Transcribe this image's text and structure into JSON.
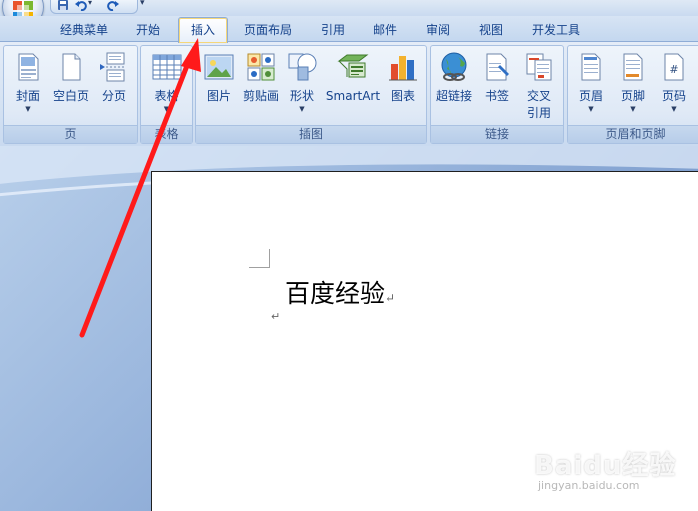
{
  "app": {
    "office_button_icon": "office-logo-icon",
    "quick_access": [
      "save-icon",
      "undo-icon",
      "redo-icon",
      "customize-dropdown-icon"
    ]
  },
  "tabs": [
    {
      "label": "经典菜单",
      "active": false
    },
    {
      "label": "开始",
      "active": false
    },
    {
      "label": "插入",
      "active": true
    },
    {
      "label": "页面布局",
      "active": false
    },
    {
      "label": "引用",
      "active": false
    },
    {
      "label": "邮件",
      "active": false
    },
    {
      "label": "审阅",
      "active": false
    },
    {
      "label": "视图",
      "active": false
    },
    {
      "label": "开发工具",
      "active": false
    }
  ],
  "ribbon": {
    "groups": {
      "pages": {
        "label": "页",
        "buttons": {
          "cover": {
            "label": "封面",
            "icon": "cover-page-icon",
            "has_dropdown": true
          },
          "blank": {
            "label": "空白页",
            "icon": "blank-page-icon"
          },
          "break": {
            "label": "分页",
            "icon": "page-break-icon"
          }
        }
      },
      "tables": {
        "label": "表格",
        "buttons": {
          "table": {
            "label": "表格",
            "icon": "table-icon",
            "has_dropdown": true
          }
        }
      },
      "illustrations": {
        "label": "插图",
        "buttons": {
          "picture": {
            "label": "图片",
            "icon": "picture-icon"
          },
          "clipart": {
            "label": "剪贴画",
            "icon": "clipart-icon"
          },
          "shapes": {
            "label": "形状",
            "icon": "shapes-icon",
            "has_dropdown": true
          },
          "smartart": {
            "label": "SmartArt",
            "icon": "smartart-icon"
          },
          "chart": {
            "label": "图表",
            "icon": "chart-icon"
          }
        }
      },
      "links": {
        "label": "链接",
        "buttons": {
          "hyperlink": {
            "label": "超链接",
            "icon": "hyperlink-globe-icon"
          },
          "bookmark": {
            "label": "书签",
            "icon": "bookmark-icon"
          },
          "crossref_1": {
            "label": "交叉",
            "icon": "cross-reference-icon"
          },
          "crossref_2": {
            "label": "引用"
          }
        }
      },
      "header_footer": {
        "label": "页眉和页脚",
        "buttons": {
          "header": {
            "label": "页眉",
            "icon": "header-icon",
            "has_dropdown": true
          },
          "footer": {
            "label": "页脚",
            "icon": "footer-icon",
            "has_dropdown": true
          },
          "page_number": {
            "label": "页码",
            "icon": "page-number-icon",
            "has_dropdown": true
          }
        }
      }
    }
  },
  "document": {
    "body_text": "百度经验",
    "paragraph_mark": "↵"
  },
  "annotation": {
    "arrow_color": "#ff1a1a",
    "points_to": "插入"
  },
  "watermark": {
    "brand": "Baidu经验",
    "url": "jingyan.baidu.com"
  },
  "colors": {
    "tab_text": "#15428b",
    "ribbon_bg": "#dbe6f4",
    "active_tab_highlight": "#f5d77a"
  }
}
